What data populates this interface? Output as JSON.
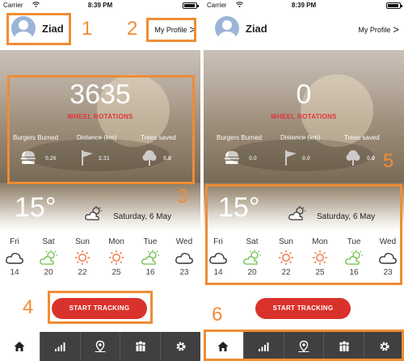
{
  "status": {
    "carrier": "Carrier",
    "time": "8:39 PM"
  },
  "profile": {
    "name": "Ziad",
    "link_label": "My Profile",
    "link_arrow": ">"
  },
  "tracking": {
    "label": "WHEEL ROTATIONS",
    "cta_label": "START TRACKING"
  },
  "stats_labels": {
    "burgers": "Burgers Burned",
    "distance": "Distance (km)",
    "trees": "Trees saved"
  },
  "screens": [
    {
      "count": "3635",
      "burgers": "0.26",
      "distance": "2.31",
      "trees": "5.0"
    },
    {
      "count": "0",
      "burgers": "0.0",
      "distance": "0.0",
      "trees": "0.0"
    }
  ],
  "weather": {
    "current_temp": "15°",
    "date": "Saturday, 6 May",
    "forecast": [
      {
        "day": "Fri",
        "temp": "14",
        "icon": "cloud-icon"
      },
      {
        "day": "Sat",
        "temp": "20",
        "icon": "partly-sunny-icon"
      },
      {
        "day": "Sun",
        "temp": "22",
        "icon": "sun-icon"
      },
      {
        "day": "Mon",
        "temp": "25",
        "icon": "sun-icon"
      },
      {
        "day": "Tue",
        "temp": "16",
        "icon": "partly-sunny-icon"
      },
      {
        "day": "Wed",
        "temp": "23",
        "icon": "cloud-icon"
      }
    ]
  },
  "tabs": [
    {
      "icon": "home-icon"
    },
    {
      "icon": "bar-chart-icon"
    },
    {
      "icon": "map-pin-icon"
    },
    {
      "icon": "group-icon"
    },
    {
      "icon": "gear-icon"
    }
  ],
  "annotations": [
    "1",
    "2",
    "3",
    "4",
    "5",
    "6"
  ],
  "colors": {
    "accent_red": "#d9322c",
    "annotation_orange": "#f08c35",
    "tabbar_dark": "#404040"
  }
}
